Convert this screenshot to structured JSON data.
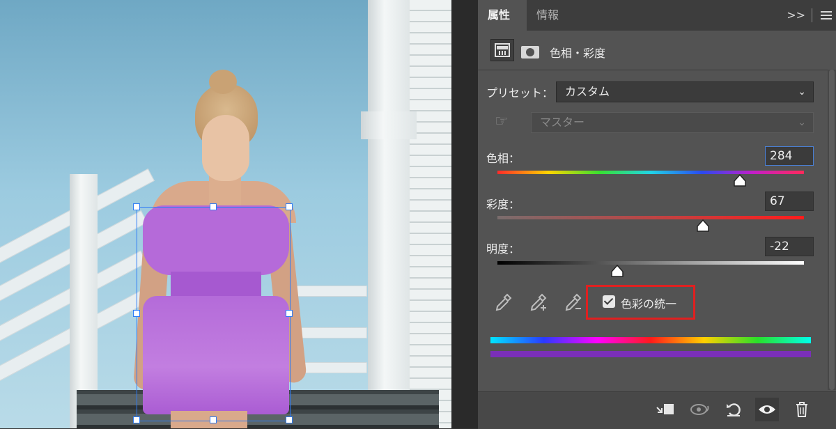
{
  "panel": {
    "tabs": [
      {
        "label": "属性",
        "active": true
      },
      {
        "label": "情報",
        "active": false
      }
    ],
    "collapse_glyph": ">>",
    "adjustment_title": "色相・彩度",
    "preset": {
      "label": "プリセット：",
      "value": "カスタム"
    },
    "channel": {
      "value": "マスター",
      "enabled": false
    },
    "hue": {
      "label": "色相：",
      "value": "284",
      "level_pct": 79
    },
    "saturation": {
      "label": "彩度：",
      "value": "67",
      "level_pct": 67
    },
    "lightness": {
      "label": "明度：",
      "value": "-22",
      "level_pct": 39
    },
    "colorize": {
      "label": "色彩の統一",
      "checked": true
    },
    "colors": {
      "accent_highlight": "#e02020",
      "result_color": "#7a2fb8",
      "focus_border": "#4a7fd3"
    },
    "bottom_icons": [
      "clip-to-layer-icon",
      "view-previous-icon",
      "reset-icon",
      "visibility-eye-icon",
      "trash-icon"
    ]
  },
  "canvas": {
    "selection_color": "#2d7cf6",
    "dress_color": "#b56ad9"
  }
}
